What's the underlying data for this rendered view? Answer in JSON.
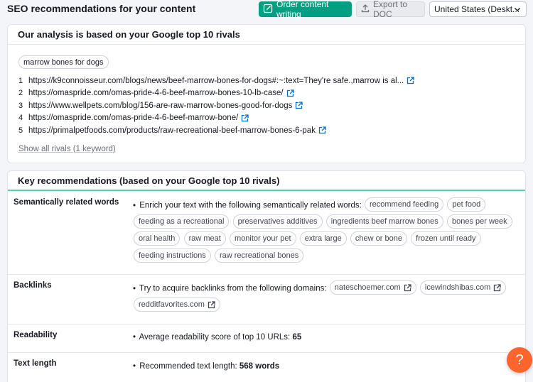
{
  "header": {
    "title": "SEO recommendations for your content",
    "order_label": "Order content writing",
    "export_label": "Export to DOC",
    "country_value": "United States (Deskt..."
  },
  "analysis": {
    "title": "Our analysis is based on your Google top 10 rivals",
    "keyword": "marrow bones for dogs",
    "rivals": [
      {
        "num": "1",
        "url": "https://k9connoisseur.com/blogs/news/beef-marrow-bones-for-dogs#:~:text=They're safe.,marrow is al..."
      },
      {
        "num": "2",
        "url": "https://omaspride.com/omas-pride-4-6-beef-marrow-bones-10-lb-case/"
      },
      {
        "num": "3",
        "url": "https://www.wellpets.com/blog/156-are-raw-marrow-bones-good-for-dogs"
      },
      {
        "num": "4",
        "url": "https://omaspride.com/omas-pride-4-6-beef-marrow-bone/"
      },
      {
        "num": "5",
        "url": "https://primalpetfoods.com/products/raw-recreational-beef-marrow-bones-6-pak"
      }
    ],
    "show_all": "Show all rivals (1 keyword)"
  },
  "recommendations": {
    "title": "Key recommendations (based on your Google top 10 rivals)",
    "semantic": {
      "label": "Semantically related words",
      "intro": "Enrich your text with the following semantically related words:",
      "words": [
        "recommend feeding",
        "pet food",
        "feeding as a recreational",
        "preservatives additives",
        "ingredients beef marrow bones",
        "bones per week",
        "oral health",
        "raw meat",
        "monitor your pet",
        "extra large",
        "chew or bone",
        "frozen until ready",
        "feeding instructions",
        "raw recreational bones"
      ]
    },
    "backlinks": {
      "label": "Backlinks",
      "intro": "Try to acquire backlinks from the following domains:",
      "domains": [
        "nateschoemer.com",
        "icewindshibas.com",
        "redditfavorites.com"
      ]
    },
    "readability": {
      "label": "Readability",
      "text": "Average readability score of top 10 URLs:",
      "value": "65"
    },
    "text_length": {
      "label": "Text length",
      "text": "Recommended text length:",
      "value": "568 words"
    }
  },
  "help": {
    "label": "?"
  },
  "colors": {
    "accent": "#009f81",
    "link": "#006dca",
    "help": "#ff642d",
    "divider": "#50d2b1"
  }
}
